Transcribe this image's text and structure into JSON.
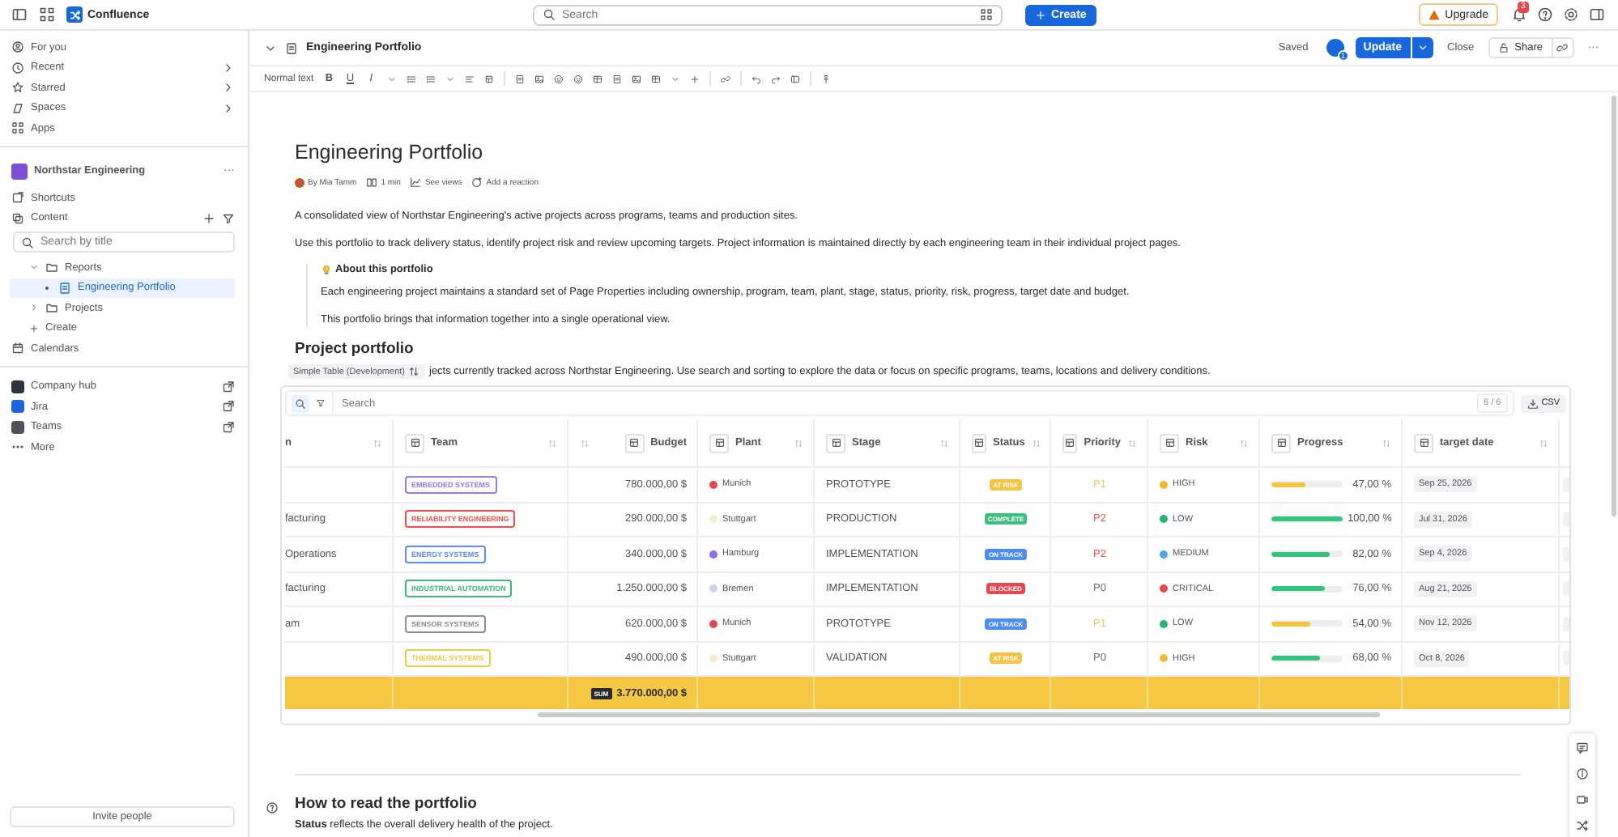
{
  "top_bar": {
    "product": "Confluence",
    "search": {
      "placeholder": "Search"
    },
    "create": "Create",
    "upgrade": "Upgrade",
    "notifications": "3"
  },
  "sidebar": {
    "nav": [
      {
        "label": "For you",
        "arrow": false
      },
      {
        "label": "Recent",
        "arrow": true
      },
      {
        "label": "Starred",
        "arrow": true
      },
      {
        "label": "Spaces",
        "arrow": true
      },
      {
        "label": "Apps",
        "arrow": false
      }
    ],
    "space": {
      "name": "Northstar Engineering",
      "more": "···"
    },
    "space_nav": [
      {
        "label": "Shortcuts"
      },
      {
        "label": "Content"
      }
    ],
    "search": {
      "placeholder": "Search by title"
    },
    "tree": [
      {
        "label": "Reports",
        "kind": "folder",
        "expanded": true,
        "selected": false,
        "children": [
          {
            "label": "Engineering Portfolio",
            "kind": "page",
            "expanded": false,
            "selected": true
          }
        ]
      },
      {
        "label": "Projects",
        "kind": "folder",
        "expanded": false,
        "selected": false
      }
    ],
    "create": "Create",
    "calendars": "Calendars",
    "links": [
      {
        "label": "Company hub",
        "color": "#2c3340"
      },
      {
        "label": "Jira",
        "color": "#1868db"
      },
      {
        "label": "Teams",
        "color": "#505258"
      }
    ],
    "more": "More",
    "invite": "Invite people"
  },
  "editor_header": {
    "page": "Engineering Portfolio",
    "saved": "Saved",
    "avatar_badge": "1",
    "update": "Update",
    "close": "Close",
    "share": "Share",
    "more": "···"
  },
  "toolbar": {
    "text_style": "Normal text",
    "format": [
      "B",
      "U",
      "I"
    ]
  },
  "page": {
    "title": "Engineering Portfolio",
    "byline": {
      "author": "By Mia Tamm",
      "read_time": "1 min",
      "views": "See views",
      "reaction": "Add a reaction"
    },
    "paragraphs": [
      "A consolidated view of Northstar Engineering's active projects across programs, teams and production sites.",
      "Use this portfolio to track delivery status, identify project risk and review upcoming targets. Project information is maintained directly by each engineering team in their individual project pages."
    ],
    "panel": {
      "title": "About this portfolio",
      "paragraphs": [
        "Each engineering project maintains a standard set of Page Properties including ownership, program, team, plant, stage, status, priority, risk, progress, target date and budget.",
        "This portfolio brings that information together into a single operational view."
      ]
    },
    "section_heading": "Project portfolio",
    "table_label": "Simple Table (Development)",
    "section_text": "jects currently tracked across Northstar Engineering. Use search and sorting to explore the data or focus on specific programs, teams, locations and delivery conditions.",
    "table": {
      "search": {
        "placeholder": "Search"
      },
      "count": "6 / 6",
      "export": "CSV",
      "columns": [
        "n",
        "Team",
        "Budget",
        "Plant",
        "Stage",
        "Status",
        "Priority",
        "Risk",
        "Progress",
        "target date"
      ],
      "rows": [
        {
          "column_1": "",
          "team": {
            "label": "EMBEDDED SYSTEMS",
            "color": "#8f7ee7"
          },
          "budget": "780.000,00 $",
          "plant": {
            "name": "Munich",
            "color": "#e5484d"
          },
          "stage": "PROTOTYPE",
          "status": {
            "label": "AT RISK",
            "color": "#f5c242"
          },
          "priority": {
            "label": "P1",
            "color": "#f2c94c"
          },
          "risk": {
            "label": "HIGH",
            "color": "#f5b82e"
          },
          "progress": {
            "level": 0.47,
            "color": "#f5c542",
            "reading": "47,00 %"
          },
          "target_date": "Sep 25, 2026"
        },
        {
          "column_1": "facturing",
          "team": {
            "label": "RELIABILITY ENGINEERING",
            "color": "#e5534b"
          },
          "budget": "290.000,00 $",
          "plant": {
            "name": "Stuttgart",
            "color": "#f6ecc9"
          },
          "stage": "PRODUCTION",
          "status": {
            "label": "COMPLETE",
            "color": "#3fbf7f"
          },
          "priority": {
            "label": "P2",
            "color": "#e5534b"
          },
          "risk": {
            "label": "LOW",
            "color": "#22b573"
          },
          "progress": {
            "level": 1.0,
            "color": "#35c47c",
            "reading": "100,00 %"
          },
          "target_date": "Jul 31, 2026"
        },
        {
          "column_1": "Operations",
          "team": {
            "label": "ENERGY SYSTEMS",
            "color": "#5b8def"
          },
          "budget": "340.000,00 $",
          "plant": {
            "name": "Hamburg",
            "color": "#8b6ff0"
          },
          "stage": "IMPLEMENTATION",
          "status": {
            "label": "ON TRACK",
            "color": "#4c8df6"
          },
          "priority": {
            "label": "P2",
            "color": "#e5534b"
          },
          "risk": {
            "label": "MEDIUM",
            "color": "#4ea8e8"
          },
          "progress": {
            "level": 0.82,
            "color": "#35c47c",
            "reading": "82,00 %"
          },
          "target_date": "Sep 4, 2026"
        },
        {
          "column_1": "facturing",
          "team": {
            "label": "INDUSTRIAL AUTOMATION",
            "color": "#3fb77a"
          },
          "budget": "1.250.000,00 $",
          "plant": {
            "name": "Bremen",
            "color": "#c9d6ea"
          },
          "stage": "IMPLEMENTATION",
          "status": {
            "label": "BLOCKED",
            "color": "#e5484d"
          },
          "priority": {
            "label": "P0",
            "color": "#6b6f76"
          },
          "risk": {
            "label": "CRITICAL",
            "color": "#e5484d"
          },
          "progress": {
            "level": 0.76,
            "color": "#35c47c",
            "reading": "76,00 %"
          },
          "target_date": "Aug 21, 2026"
        },
        {
          "column_1": "am",
          "team": {
            "label": "SENSOR SYSTEMS",
            "color": "#8a8f98"
          },
          "budget": "620.000,00 $",
          "plant": {
            "name": "Munich",
            "color": "#e5484d"
          },
          "stage": "PROTOTYPE",
          "status": {
            "label": "ON TRACK",
            "color": "#4c8df6"
          },
          "priority": {
            "label": "P1",
            "color": "#f2c94c"
          },
          "risk": {
            "label": "LOW",
            "color": "#22b573"
          },
          "progress": {
            "level": 0.54,
            "color": "#f5c542",
            "reading": "54,00 %"
          },
          "target_date": "Nov 12, 2026"
        },
        {
          "column_1": "",
          "team": {
            "label": "THERMAL SYSTEMS",
            "color": "#f2c94c"
          },
          "budget": "490.000,00 $",
          "plant": {
            "name": "Stuttgart",
            "color": "#f6ecc9"
          },
          "stage": "VALIDATION",
          "status": {
            "label": "AT RISK",
            "color": "#f5c242"
          },
          "priority": {
            "label": "P0",
            "color": "#6b6f76"
          },
          "risk": {
            "label": "HIGH",
            "color": "#f5b82e"
          },
          "progress": {
            "level": 0.68,
            "color": "#35c47c",
            "reading": "68,00 %"
          },
          "target_date": "Oct 8, 2026"
        }
      ],
      "sum": {
        "badge": "SUM",
        "value": "3.770.000,00 $"
      }
    },
    "next_heading": "How to read the portfolio",
    "next_text": "**Status** reflects the overall delivery health of the project."
  }
}
